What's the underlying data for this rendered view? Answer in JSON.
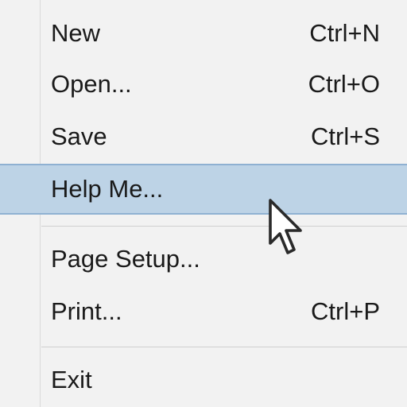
{
  "menu": {
    "items": [
      {
        "label": "New",
        "shortcut": "Ctrl+N"
      },
      {
        "label": "Open...",
        "shortcut": "Ctrl+O"
      },
      {
        "label": "Save",
        "shortcut": "Ctrl+S"
      },
      {
        "label": "Help Me...",
        "shortcut": "",
        "highlighted": true
      },
      {
        "label": "Page Setup...",
        "shortcut": ""
      },
      {
        "label": "Print...",
        "shortcut": "Ctrl+P"
      },
      {
        "label": "Exit",
        "shortcut": ""
      }
    ]
  },
  "colors": {
    "menu_background": "#f2f2f2",
    "highlight_fill": "#bdd3e6",
    "highlight_border": "#8fb1d2",
    "text": "#1a1a1a"
  },
  "icons": {
    "cursor": "mouse-pointer-icon"
  }
}
